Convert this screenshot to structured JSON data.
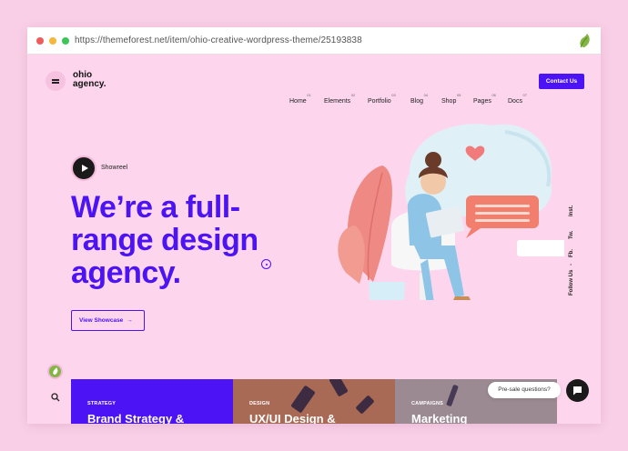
{
  "browser": {
    "url": "https://themeforest.net/item/ohio-creative-wordpress-theme/25193838",
    "extension_icon": "envato-leaf-icon"
  },
  "header": {
    "logo_line1": "ohio",
    "logo_line2": "agency.",
    "nav": [
      {
        "label": "Home",
        "num": "01"
      },
      {
        "label": "Elements",
        "num": "02"
      },
      {
        "label": "Portfolio",
        "num": "03"
      },
      {
        "label": "Blog",
        "num": "04"
      },
      {
        "label": "Shop",
        "num": "05"
      },
      {
        "label": "Pages",
        "num": "06"
      },
      {
        "label": "Docs",
        "num": "07"
      }
    ],
    "contact_label": "Contact Us"
  },
  "hero": {
    "showreel_label": "Showreel",
    "headline_line1": "We’re a full-",
    "headline_line2": "range design",
    "headline_line3": "agency.",
    "showcase_label": "View Showcase",
    "showcase_arrow": "→"
  },
  "social": {
    "follow": "Follow Us",
    "sep": "-",
    "fb": "Fb.",
    "tw": "Tw.",
    "ins": "Inst."
  },
  "cards": [
    {
      "category": "STRATEGY",
      "title": "Brand Strategy &"
    },
    {
      "category": "DESIGN",
      "title": "UX/UI Design &"
    },
    {
      "category": "CAMPAIGNS",
      "title": "Marketing"
    }
  ],
  "chat": {
    "tooltip": "Pre-sale questions?"
  },
  "colors": {
    "accent": "#4c14f5",
    "page_bg": "#fdd6ee"
  }
}
